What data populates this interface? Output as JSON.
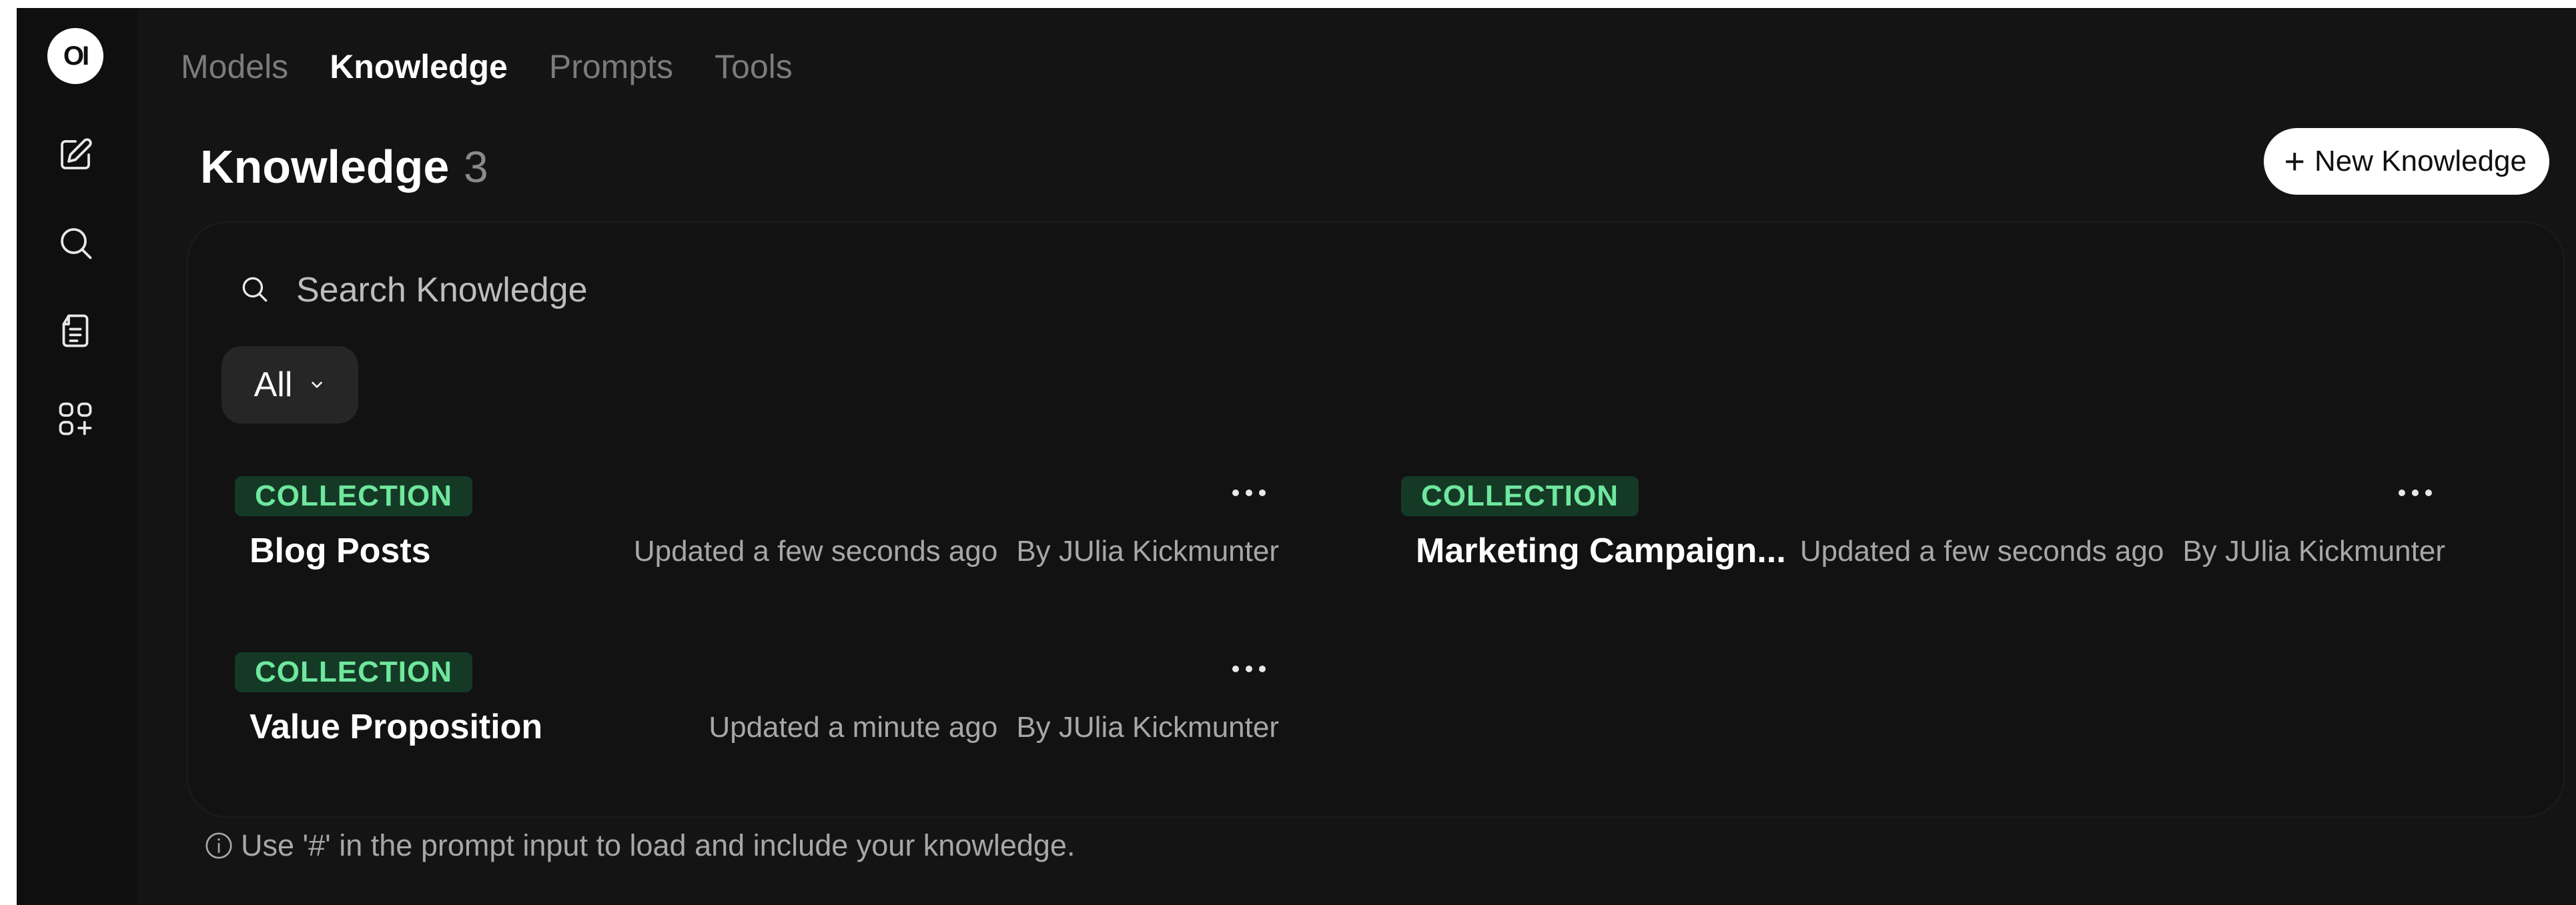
{
  "app": {
    "logo_text": "OI"
  },
  "sidebar": {
    "items": [
      {
        "icon": "pencil-square-icon"
      },
      {
        "icon": "search-icon"
      },
      {
        "icon": "notes-icon"
      },
      {
        "icon": "apps-plus-icon"
      }
    ]
  },
  "tabs": [
    {
      "label": "Models",
      "active": false
    },
    {
      "label": "Knowledge",
      "active": true
    },
    {
      "label": "Prompts",
      "active": false
    },
    {
      "label": "Tools",
      "active": false
    }
  ],
  "header": {
    "title": "Knowledge",
    "count": "3",
    "new_button_label": "New Knowledge",
    "new_button_icon": "plus-icon"
  },
  "search": {
    "placeholder": "Search Knowledge",
    "value": ""
  },
  "filter": {
    "selected": "All"
  },
  "items": [
    {
      "badge": "COLLECTION",
      "title": "Blog Posts",
      "updated": "Updated a few seconds ago",
      "by": "By JUlia Kickmunter"
    },
    {
      "badge": "COLLECTION",
      "title": "Marketing Campaign...",
      "updated": "Updated a few seconds ago",
      "by": "By JUlia Kickmunter"
    },
    {
      "badge": "COLLECTION",
      "title": "Value Proposition",
      "updated": "Updated a minute ago",
      "by": "By JUlia Kickmunter"
    }
  ],
  "footer": {
    "note": "Use '#' in the prompt input to load and include your knowledge."
  },
  "colors": {
    "background": "#141414",
    "badge_bg": "#143a26",
    "badge_text": "#6fe79e",
    "muted_text": "#a7a7a7"
  }
}
